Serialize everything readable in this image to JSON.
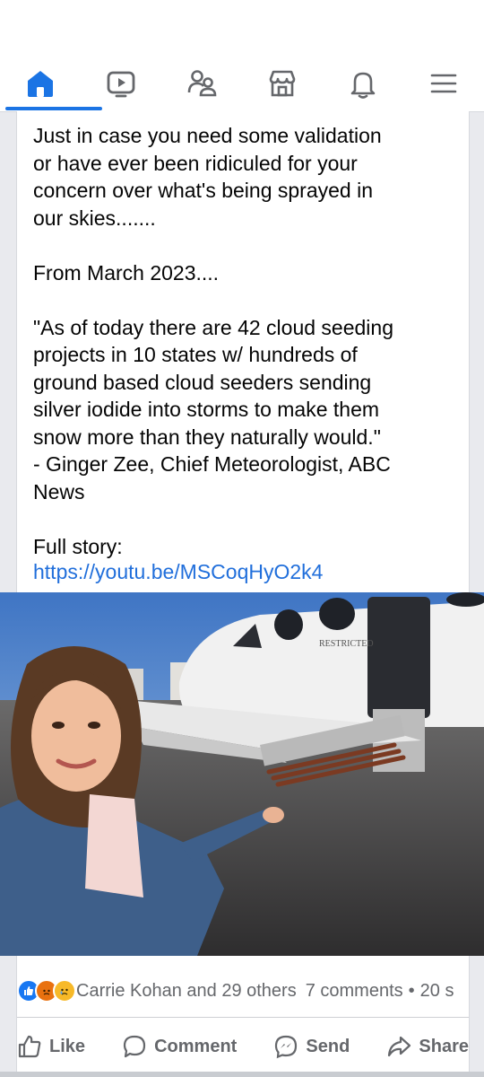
{
  "nav": {
    "items": [
      {
        "name": "home",
        "icon": "home-icon",
        "active": true
      },
      {
        "name": "video",
        "icon": "video-icon",
        "active": false
      },
      {
        "name": "friends",
        "icon": "friends-icon",
        "active": false
      },
      {
        "name": "marketplace",
        "icon": "marketplace-icon",
        "active": false
      },
      {
        "name": "notifications",
        "icon": "bell-icon",
        "active": false
      },
      {
        "name": "menu",
        "icon": "hamburger-menu-icon",
        "active": false
      }
    ],
    "accent": "#1b74e4"
  },
  "post": {
    "text": "Just in case you need some validation\nor have ever been ridiculed for your\nconcern over what's being sprayed in\nour skies.......\n\nFrom March 2023....\n\n\"As of today there are 42 cloud seeding\nprojects in 10 states w/ hundreds of\nground based cloud seeders sending\nsilver iodide into storms to make them\nsnow more than they naturally would.\"\n - Ginger Zee, Chief Meteorologist, ABC\nNews\n\nFull story:",
    "link": "https://youtu.be/MSCoqHyO2k4",
    "link_color": "#216fdb"
  },
  "photo": {
    "plane_text": "RESTRICTED"
  },
  "engagement": {
    "reactors": "Carrie Kohan and 29 others",
    "comments": "7 comments",
    "separator": "•",
    "shares": "20 s",
    "reaction_icons": [
      "like-reaction-icon",
      "angry-reaction-icon",
      "sad-reaction-icon"
    ]
  },
  "actions": {
    "like": "Like",
    "comment": "Comment",
    "send": "Send",
    "share": "Share"
  }
}
